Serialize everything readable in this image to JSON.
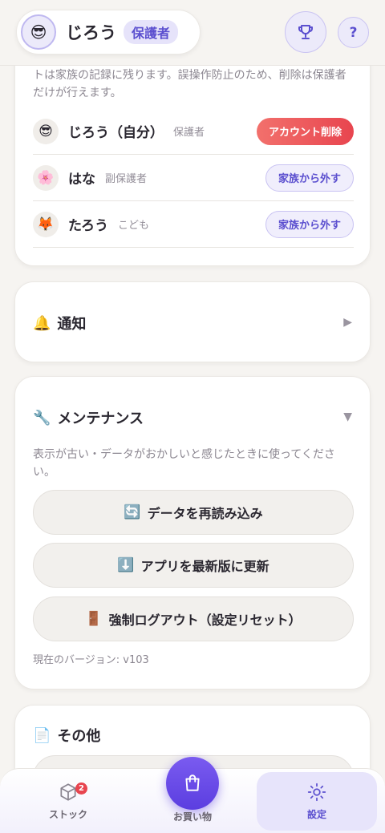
{
  "header": {
    "user_name": "じろう",
    "user_role": "保護者",
    "avatar_emoji": "😎"
  },
  "family": {
    "notice": "トは家族の記録に残ります。誤操作防止のため、削除は保護者だけが行えます。",
    "members": [
      {
        "emoji": "😎",
        "name": "じろう（自分）",
        "role": "保護者",
        "action": "アカウント削除"
      },
      {
        "emoji": "🌸",
        "name": "はな",
        "role": "副保護者",
        "action": "家族から外す"
      },
      {
        "emoji": "🦊",
        "name": "たろう",
        "role": "こども",
        "action": "家族から外す"
      }
    ]
  },
  "notifications": {
    "icon": "🔔",
    "title": "通知",
    "caret": "▶"
  },
  "maintenance": {
    "icon": "🔧",
    "title": "メンテナンス",
    "caret": "▼",
    "description": "表示が古い・データがおかしいと感じたときに使ってください。",
    "buttons": [
      {
        "icon": "🔄",
        "label": "データを再読み込み"
      },
      {
        "icon": "⬇️",
        "label": "アプリを最新版に更新"
      },
      {
        "icon": "🚪",
        "label": "強制ログアウト（設定リセット）"
      }
    ],
    "version": "現在のバージョン: v103"
  },
  "other": {
    "icon": "📄",
    "title": "その他"
  },
  "bottom_nav": {
    "stock_label": "ストック",
    "stock_badge": "2",
    "shopping_label": "お買い物",
    "settings_label": "設定"
  },
  "colors": {
    "accent": "#5b4fcf",
    "danger": "#e8454f",
    "background": "#f6f4f1"
  }
}
